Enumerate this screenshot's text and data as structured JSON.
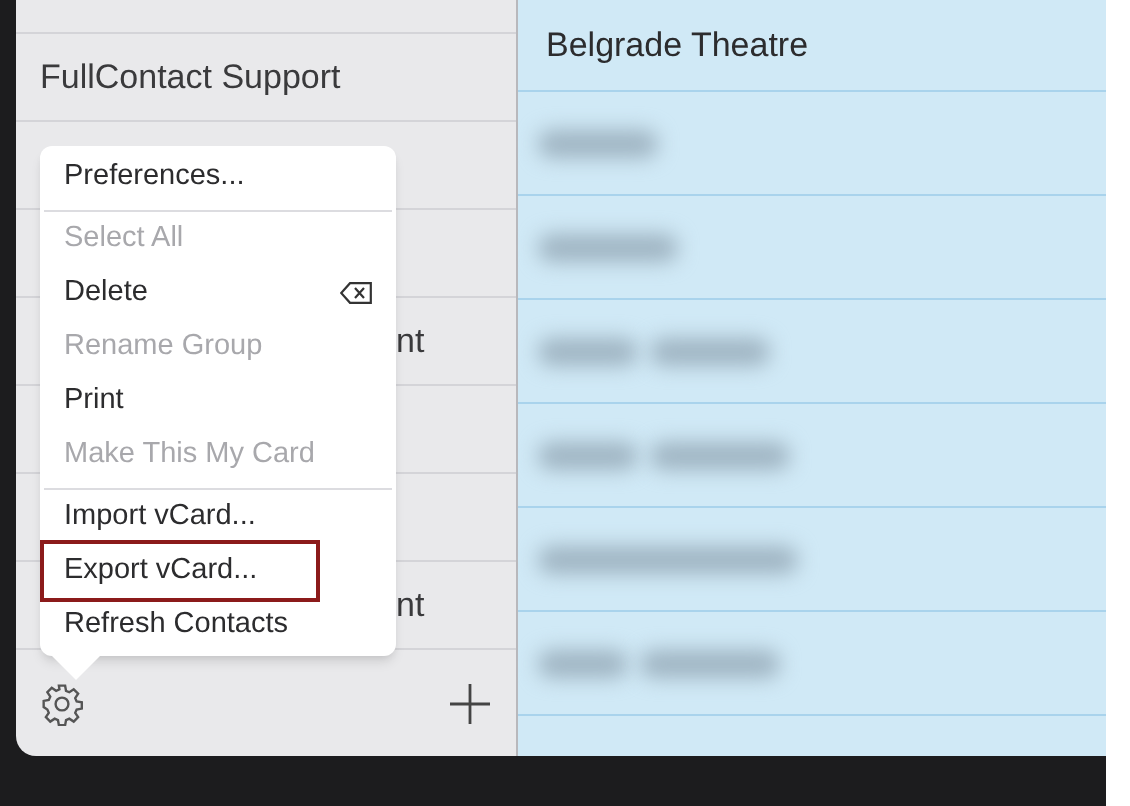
{
  "sidebar": {
    "groups": [
      {
        "kind": "text",
        "label": "FullContact Support"
      },
      {
        "kind": "covered"
      },
      {
        "kind": "covered"
      },
      {
        "kind": "text",
        "label": "nt"
      },
      {
        "kind": "covered"
      },
      {
        "kind": "covered"
      },
      {
        "kind": "text",
        "label": "nt"
      }
    ]
  },
  "menu": {
    "items": [
      {
        "label": "Preferences...",
        "disabled": false,
        "highlighted": false,
        "separator_after": true
      },
      {
        "label": "Select All",
        "disabled": true,
        "highlighted": false,
        "separator_after": false
      },
      {
        "label": "Delete",
        "disabled": false,
        "highlighted": false,
        "separator_after": false,
        "kind": "delete"
      },
      {
        "label": "Rename Group",
        "disabled": true,
        "highlighted": false,
        "separator_after": false
      },
      {
        "label": "Print",
        "disabled": false,
        "highlighted": false,
        "separator_after": false
      },
      {
        "label": "Make This My Card",
        "disabled": true,
        "highlighted": false,
        "separator_after": true
      },
      {
        "label": "Import vCard...",
        "disabled": false,
        "highlighted": false,
        "separator_after": false
      },
      {
        "label": "Export vCard...",
        "disabled": false,
        "highlighted": true,
        "separator_after": false
      },
      {
        "label": "Refresh Contacts",
        "disabled": false,
        "highlighted": false,
        "separator_after": false
      }
    ]
  },
  "contacts": [
    {
      "kind": "name",
      "name": "Belgrade Theatre"
    },
    {
      "kind": "redacted"
    },
    {
      "kind": "redacted"
    },
    {
      "kind": "redacted"
    },
    {
      "kind": "redacted"
    },
    {
      "kind": "redacted"
    },
    {
      "kind": "redacted"
    }
  ]
}
